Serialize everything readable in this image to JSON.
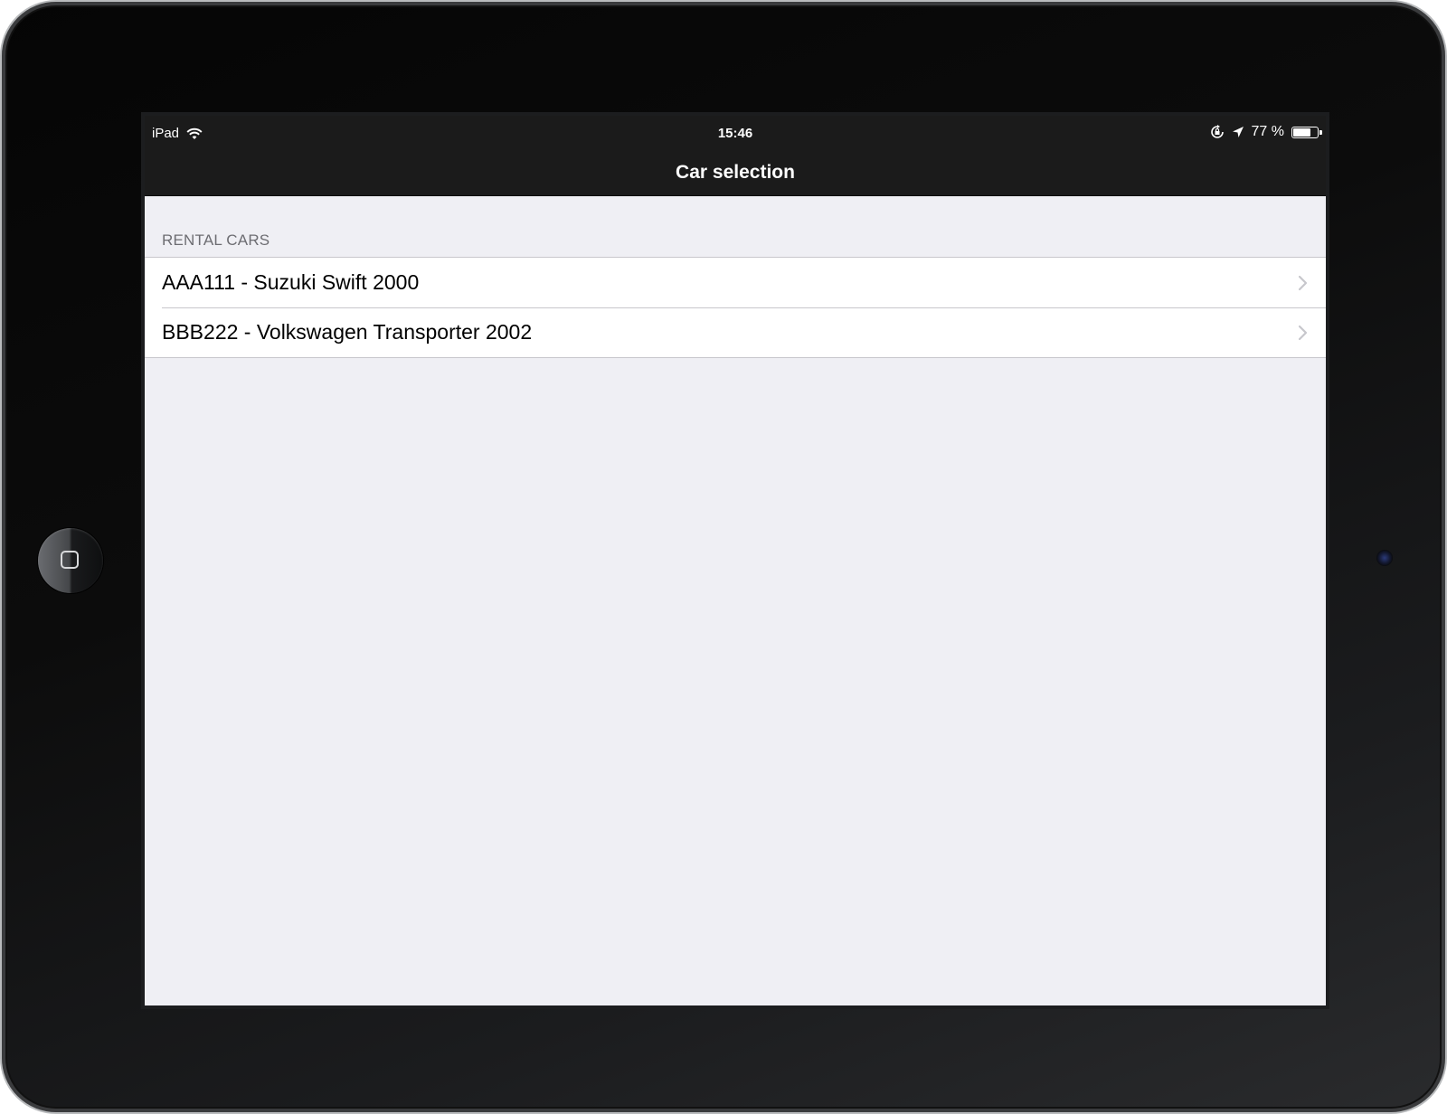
{
  "device": {
    "home_button_icon": "home-square-icon",
    "camera_icon": "front-camera-icon"
  },
  "status_bar": {
    "carrier": "iPad",
    "wifi_icon": "wifi-icon",
    "time": "15:46",
    "rotation_lock_icon": "rotation-lock-icon",
    "location_icon": "location-arrow-icon",
    "battery_percent_text": "77 %",
    "battery_level": 0.77,
    "battery_icon": "battery-icon"
  },
  "nav": {
    "title": "Car selection"
  },
  "section": {
    "header": "RENTAL CARS",
    "rows": [
      {
        "label": "AAA111 - Suzuki Swift 2000",
        "accessory": "chevron-right-icon"
      },
      {
        "label": "BBB222 - Volkswagen Transporter 2002",
        "accessory": "chevron-right-icon"
      }
    ]
  },
  "colors": {
    "bar_background": "#1b1b1b",
    "table_background": "#efeff4",
    "separator": "#c8c7cc",
    "section_header_text": "#6d6d72",
    "chevron": "#c7c7cc"
  }
}
